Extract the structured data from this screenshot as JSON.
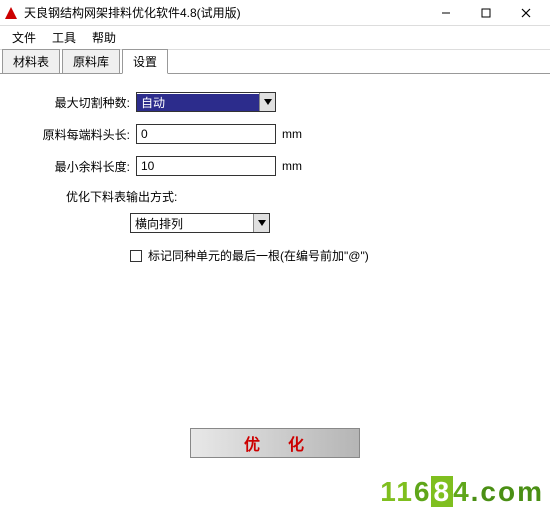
{
  "window": {
    "title": "天良钢结构网架排料优化软件4.8(试用版)"
  },
  "menu": {
    "file": "文件",
    "tools": "工具",
    "help": "帮助"
  },
  "tabs": {
    "material_table": "材料表",
    "raw_library": "原料库",
    "settings": "设置"
  },
  "form": {
    "max_cut_types_label": "最大切割种数:",
    "max_cut_types_value": "自动",
    "raw_end_head_label": "原料每端料头长:",
    "raw_end_head_value": "0",
    "min_remain_label": "最小余料长度:",
    "min_remain_value": "10",
    "unit": "mm",
    "output_mode_label": "优化下料表输出方式:",
    "output_mode_value": "横向排列",
    "mark_last_label": "标记同种单元的最后一根(在编号前加\"@\")"
  },
  "buttons": {
    "optimize": "优 化"
  },
  "watermark": {
    "text": "11684.com"
  }
}
